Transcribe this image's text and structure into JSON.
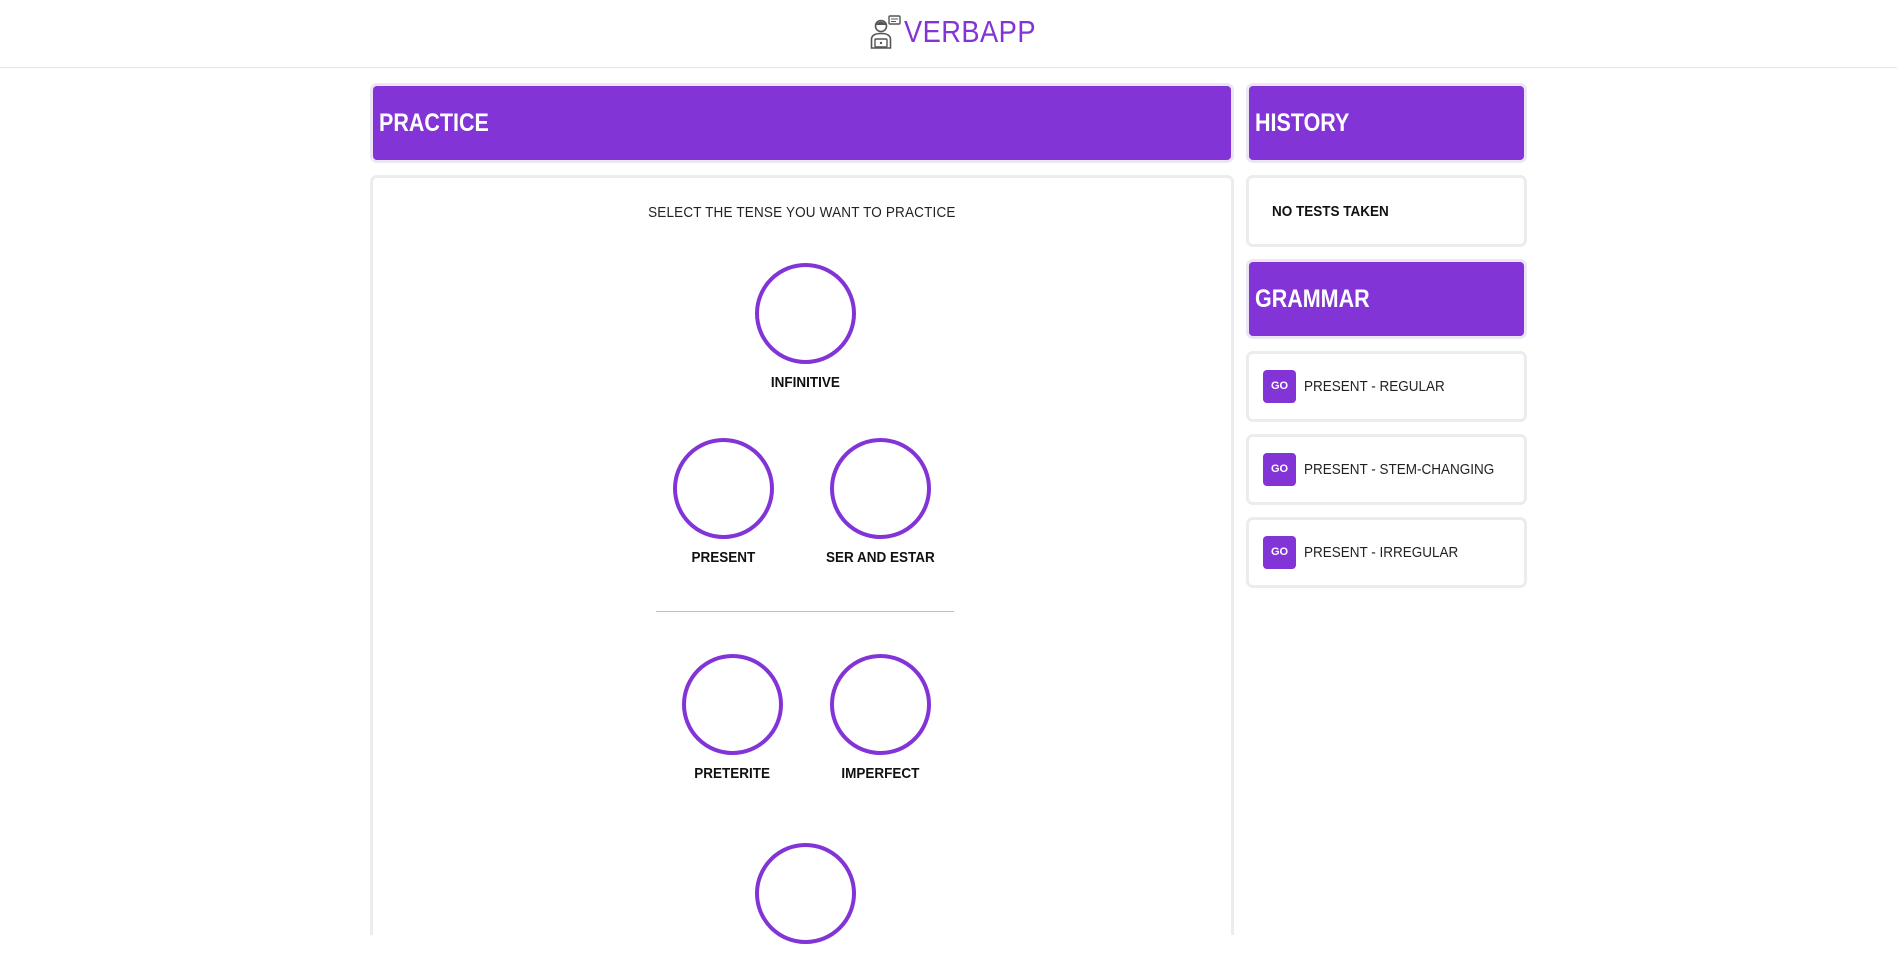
{
  "app": {
    "name": "VERBAPP",
    "brand_color": "#8234d6",
    "logo_icon": "student-laptop-icon"
  },
  "practice": {
    "title": "PRACTICE",
    "instruction": "SELECT THE TENSE YOU WANT TO PRACTICE",
    "tenses": [
      {
        "label": "INFINITIVE"
      },
      {
        "label": "PRESENT"
      },
      {
        "label": "SER AND ESTAR"
      },
      {
        "label": "PRETERITE"
      },
      {
        "label": "IMPERFECT"
      },
      {
        "label": ""
      }
    ]
  },
  "history": {
    "title": "HISTORY",
    "empty_text": "NO TESTS TAKEN"
  },
  "grammar": {
    "title": "GRAMMAR",
    "button_label": "GO",
    "items": [
      {
        "label": "PRESENT - REGULAR"
      },
      {
        "label": "PRESENT - STEM-CHANGING"
      },
      {
        "label": "PRESENT - IRREGULAR"
      }
    ]
  }
}
